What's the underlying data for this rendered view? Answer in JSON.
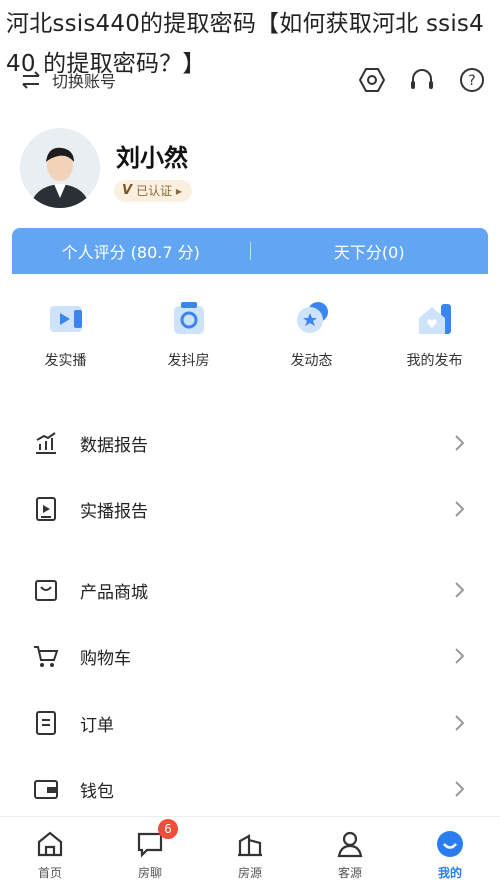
{
  "overlay_title": "河北ssis440的提取密码【如何获取河北 ssis440 的提取密码？】",
  "topbar": {
    "switch_label": "切换账号",
    "icons": [
      "settings-hex-icon",
      "headset-icon",
      "help-icon"
    ]
  },
  "profile": {
    "name": "刘小然",
    "badge_mark": "V",
    "badge_label": "已认证 ▸"
  },
  "score_bar": {
    "left": "个人评分 (80.7 分)",
    "right": "天下分(0)"
  },
  "quick_actions": [
    {
      "label": "发实播",
      "icon": "video-icon"
    },
    {
      "label": "发抖房",
      "icon": "camera-icon"
    },
    {
      "label": "发动态",
      "icon": "star-bubble-icon"
    },
    {
      "label": "我的发布",
      "icon": "house-icon"
    }
  ],
  "menu": [
    {
      "label": "数据报告",
      "icon": "chart-icon"
    },
    {
      "label": "实播报告",
      "icon": "play-doc-icon"
    },
    {
      "label": "产品商城",
      "icon": "shop-icon"
    },
    {
      "label": "购物车",
      "icon": "cart-icon"
    },
    {
      "label": "订单",
      "icon": "order-icon"
    },
    {
      "label": "钱包",
      "icon": "wallet-icon"
    }
  ],
  "tabbar": {
    "tabs": [
      {
        "label": "首页",
        "icon": "home-icon"
      },
      {
        "label": "房聊",
        "icon": "chat-icon",
        "badge": "6"
      },
      {
        "label": "房源",
        "icon": "building-icon"
      },
      {
        "label": "客源",
        "icon": "person-icon"
      },
      {
        "label": "我的",
        "icon": "me-icon",
        "active": true
      }
    ]
  },
  "colors": {
    "accent": "#2a7df0",
    "score_bar": "#62a6f3",
    "badge_bg": "#fbf0df",
    "unread": "#f04d3a"
  }
}
